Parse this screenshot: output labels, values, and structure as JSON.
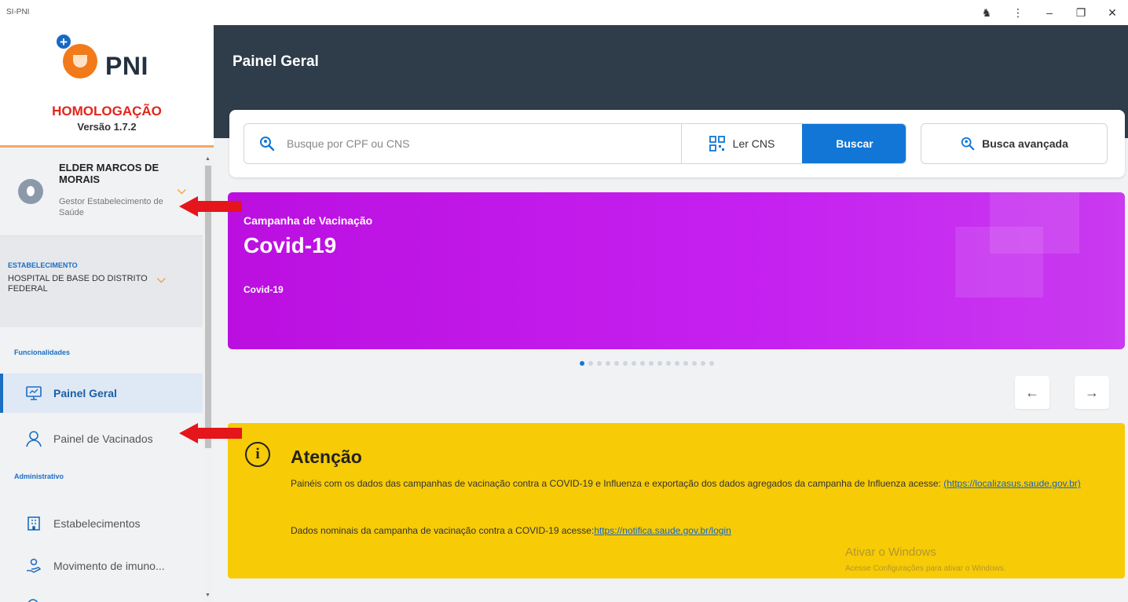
{
  "window": {
    "title": "SI-PNI",
    "controls": {
      "extensions": "♞",
      "menu": "⋮",
      "minimize": "–",
      "restore": "❐",
      "close": "✕"
    }
  },
  "sidebar": {
    "brand": {
      "logo_text": "PNI",
      "environment": "HOMOLOGAÇÃO",
      "version": "Versão 1.7.2"
    },
    "user": {
      "name": "ELDER MARCOS DE MORAIS",
      "role": "Gestor Estabelecimento de Saúde"
    },
    "establishment": {
      "label": "ESTABELECIMENTO",
      "name": "HOSPITAL DE BASE DO DISTRITO FEDERAL"
    },
    "sections": {
      "features": "Funcionalidades",
      "admin": "Administrativo"
    },
    "items": [
      {
        "label": "Painel Geral",
        "icon": "monitor-icon",
        "active": true
      },
      {
        "label": "Painel de Vacinados",
        "icon": "person-icon",
        "active": false
      },
      {
        "label": "Estabelecimentos",
        "icon": "building-icon",
        "active": false
      },
      {
        "label": "Movimento de imuno...",
        "icon": "hand-icon",
        "active": false
      }
    ]
  },
  "main": {
    "header_title": "Painel Geral",
    "search": {
      "placeholder": "Busque por CPF ou CNS",
      "read_cns_label": "Ler CNS",
      "search_button": "Buscar",
      "advanced_button": "Busca avançada"
    },
    "banner": {
      "subtitle": "Campanha de Vacinação",
      "title": "Covid-19",
      "description": "Covid-19",
      "slide_count": 16,
      "active_slide": 1
    },
    "carousel": {
      "prev": "←",
      "next": "→"
    },
    "notice": {
      "title": "Atenção",
      "text1": "Painéis com os dados das campanhas de vacinação contra a COVID-19 e Influenza e exportação dos dados agregados da campanha de Influenza acesse:",
      "link1": "(https://localizasus.saude.gov.br)",
      "text2": "Dados nominais da campanha de vacinação contra a COVID-19 acesse:",
      "link2": "https://notifica.saude.gov.br/login",
      "watermark_title": "Ativar o Windows",
      "watermark_sub": "Acesse Configurações para ativar o Windows."
    }
  },
  "colors": {
    "accent": "#1276d6",
    "header": "#2f3c4a",
    "banner": "#c521f0",
    "notice": "#f7cb06",
    "annotation": "#e4151b"
  }
}
